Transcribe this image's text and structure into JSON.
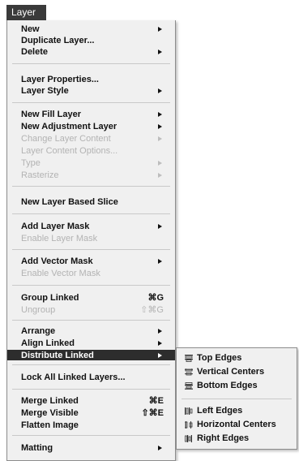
{
  "menubar": {
    "title": "Layer"
  },
  "menu": {
    "items": [
      {
        "label": "New",
        "has_submenu": true
      },
      {
        "label": "Duplicate Layer..."
      },
      {
        "label": "Delete",
        "has_submenu": true
      },
      {
        "label": "Layer Properties..."
      },
      {
        "label": "Layer Style",
        "has_submenu": true
      },
      {
        "label": "New Fill Layer",
        "has_submenu": true
      },
      {
        "label": "New Adjustment Layer",
        "has_submenu": true
      },
      {
        "label": "Change Layer Content",
        "has_submenu": true,
        "disabled": true
      },
      {
        "label": "Layer Content Options...",
        "disabled": true
      },
      {
        "label": "Type",
        "has_submenu": true,
        "disabled": true
      },
      {
        "label": "Rasterize",
        "has_submenu": true,
        "disabled": true
      },
      {
        "label": "New Layer Based Slice"
      },
      {
        "label": "Add Layer Mask",
        "has_submenu": true
      },
      {
        "label": "Enable Layer Mask",
        "disabled": true
      },
      {
        "label": "Add Vector Mask",
        "has_submenu": true
      },
      {
        "label": "Enable Vector Mask",
        "disabled": true
      },
      {
        "label": "Group Linked",
        "shortcut": "⌘G"
      },
      {
        "label": "Ungroup",
        "shortcut": "⇧⌘G",
        "disabled": true
      },
      {
        "label": "Arrange",
        "has_submenu": true
      },
      {
        "label": "Align Linked",
        "has_submenu": true
      },
      {
        "label": "Distribute Linked",
        "has_submenu": true,
        "highlighted": true
      },
      {
        "label": "Lock All Linked Layers..."
      },
      {
        "label": "Merge Linked",
        "shortcut": "⌘E"
      },
      {
        "label": "Merge Visible",
        "shortcut": "⇧⌘E"
      },
      {
        "label": "Flatten Image"
      },
      {
        "label": "Matting",
        "has_submenu": true
      }
    ]
  },
  "submenu": {
    "items": [
      {
        "label": "Top Edges",
        "icon": "distribute-top-edges-icon"
      },
      {
        "label": "Vertical Centers",
        "icon": "distribute-vertical-centers-icon"
      },
      {
        "label": "Bottom Edges",
        "icon": "distribute-bottom-edges-icon"
      },
      {
        "label": "Left Edges",
        "icon": "distribute-left-edges-icon"
      },
      {
        "label": "Horizontal Centers",
        "icon": "distribute-horizontal-centers-icon"
      },
      {
        "label": "Right Edges",
        "icon": "distribute-right-edges-icon"
      }
    ]
  }
}
